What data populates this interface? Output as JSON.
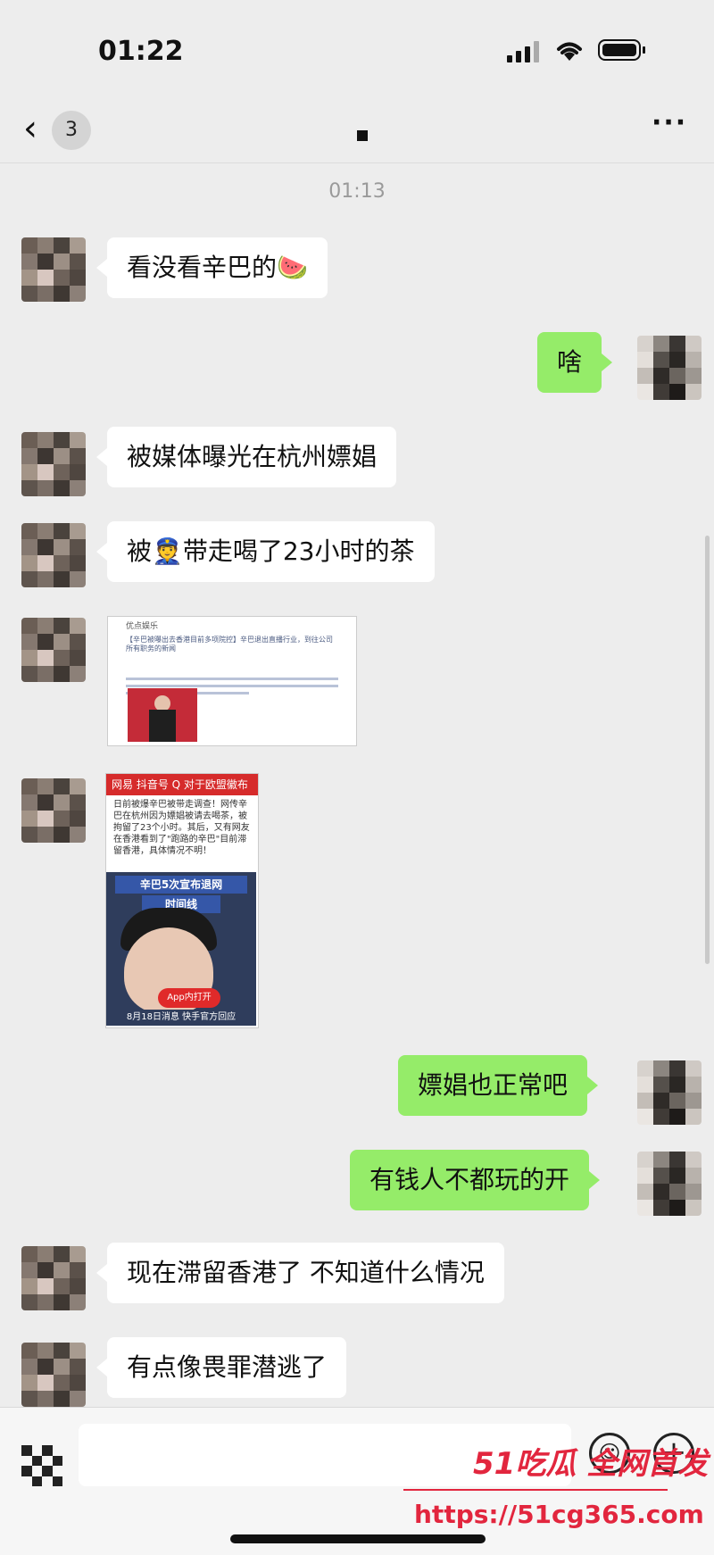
{
  "status_bar": {
    "time": "01:22"
  },
  "nav": {
    "back_icon": "chevron-left",
    "unread_count": "3",
    "title": "■",
    "more_icon": "···"
  },
  "timestamp": "01:13",
  "messages": [
    {
      "side": "left",
      "text": "看没看辛巴的🍉"
    },
    {
      "side": "right",
      "text": "啥"
    },
    {
      "side": "left",
      "text": "被媒体曝光在杭州嫖娼"
    },
    {
      "side": "left",
      "text": "被👮带走喝了23小时的茶"
    },
    {
      "side": "left",
      "type": "image",
      "image_text": {
        "author": "优点娱乐",
        "body": "【辛巴被曝出去香港目前多项院控】辛巴退出直播行业，到往公司所有职务的新闻"
      }
    },
    {
      "side": "left",
      "type": "image",
      "image_text": {
        "top": "网易  抖音号   Q 对于欧盟徽布 粉角...",
        "body": "日前被爆辛巴被带走调查！网传辛巴在杭州因为嫖娼被请去喝茶，被拘留了23个小时。其后，又有网友在香港看到了\"跑路的辛巴\"目前滞留香港，具体情况不明！",
        "banner": "辛巴5次宣布退网",
        "banner2": "时间线",
        "app_btn": "App内打开",
        "footer": "8月18日消息  快手官方回应"
      }
    },
    {
      "side": "right",
      "text": "嫖娼也正常吧"
    },
    {
      "side": "right",
      "text": "有钱人不都玩的开"
    },
    {
      "side": "left",
      "text": "现在滞留香港了 不知道什么情况"
    },
    {
      "side": "left",
      "text": "有点像畏罪潜逃了"
    }
  ],
  "input_bar": {
    "voice_icon": "voice-icon",
    "emoji_icon": "☺",
    "plus_icon": "+"
  },
  "watermark": {
    "line1": "51吃瓜 全网首发",
    "line2": "https://51cg365.com"
  }
}
